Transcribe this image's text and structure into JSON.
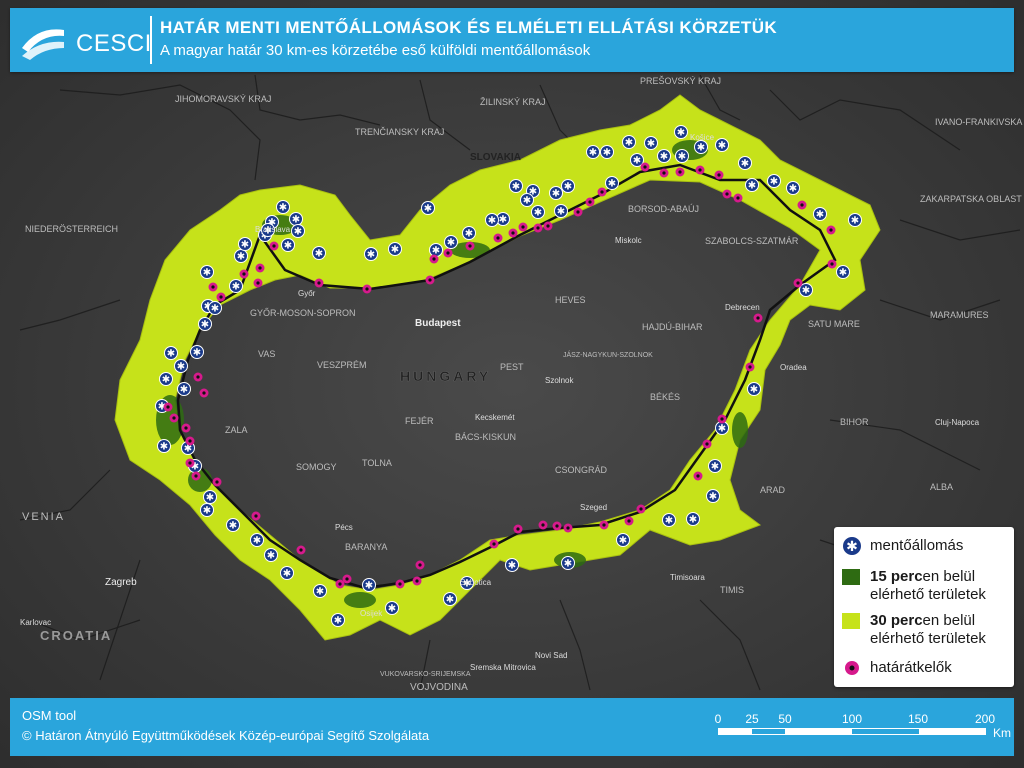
{
  "header": {
    "logo_text": "CESCI",
    "title": "HATÁR MENTI MENTŐÁLLOMÁSOK ÉS ELMÉLETI ELLÁTÁSI KÖRZETÜK",
    "subtitle": "A magyar határ 30 km-es körzetébe eső külföldi mentőállomások"
  },
  "legend": {
    "station": "mentőállomás",
    "zone15_bold": "15 perc",
    "zone15_rest": "en belül",
    "zone15_line2": "elérhető területek",
    "zone30_bold": "30 perc",
    "zone30_rest": "en belül",
    "zone30_line2": "elérhető területek",
    "crossing": "határátkelők"
  },
  "colors": {
    "zone30": "#c6e21a",
    "zone15": "#2e6b12",
    "station_fill": "#1a3a8a",
    "crossing": "#d61a8c",
    "border": "#111111",
    "header_bg": "#2aa5dc"
  },
  "footer": {
    "credit1": "OSM tool",
    "credit2": "© Határon Átnyúló Együttműködések Közép-európai Segítő Szolgálata",
    "scale_ticks": [
      "0",
      "25",
      "50",
      "100",
      "150",
      "200"
    ],
    "scale_unit": "Km"
  },
  "labels": {
    "country_hu": "HUNGARY",
    "budapest": "Budapest",
    "slovakia": "SLOVAKIA",
    "croatia": "CROATIA",
    "vojvodina": "VOJVODINA",
    "zagreb": "Zagreb",
    "szeged": "Szeged",
    "debrecen": "Debrecen",
    "pecs": "Pécs",
    "gyor": "Győr",
    "miskolc": "Miskolc",
    "timisoara": "Timisoara",
    "oradea": "Oradea",
    "kosice": "Košice",
    "subotica": "Subotica",
    "novi_sad": "Novi Sad",
    "kecskemet": "Kecskemét",
    "szolnok": "Szolnok",
    "bekes": "BÉKÉS",
    "heves": "HEVES",
    "pest": "PEST",
    "fejer": "FEJÉR",
    "tolna": "TOLNA",
    "somogy": "SOMOGY",
    "baranya": "BARANYA",
    "zala": "ZALA",
    "vas": "VAS",
    "veszprem": "VESZPRÉM",
    "csongrad": "CSONGRÁD",
    "bacs_kiskun": "BÁCS-KISKUN",
    "hajdu_bihar": "HAJDÚ-BIHAR",
    "jasz": "JÁSZ-NAGYKUN-SZOLNOK",
    "borsod": "BORSOD-ABAÚJ",
    "szabolcs": "SZABOLCS-SZATMÁR",
    "gyor_moson": "GYŐR-MOSON-SOPRON",
    "timis": "TIMIS",
    "bihor": "BIHOR",
    "arad": "ARAD",
    "satu_mare": "SATU MARE",
    "alba": "ALBA",
    "cluj": "Cluj-Napoca",
    "bratislava": "Bratislava",
    "trencin": "TRENČIANSKY KRAJ",
    "zilina": "ŽILINSKÝ KRAJ",
    "presov": "PREŠOVSKÝ KRAJ",
    "jihomoravsky": "JIHOMORAVSKÝ KRAJ",
    "zakarpatska": "ZAKARPATSKA OBLAST",
    "ivano": "IVANO-FRANKIVSKA",
    "maramures": "MARAMURES",
    "vukovar": "VUKOVARSKO-SRIJEMSKA",
    "osijek": "Osijek",
    "karlovac": "Karlovac",
    "venia": "VENIA",
    "niederosterreich": "NIEDERÖSTERREICH",
    "sremska": "Sremska Mitrovica"
  }
}
